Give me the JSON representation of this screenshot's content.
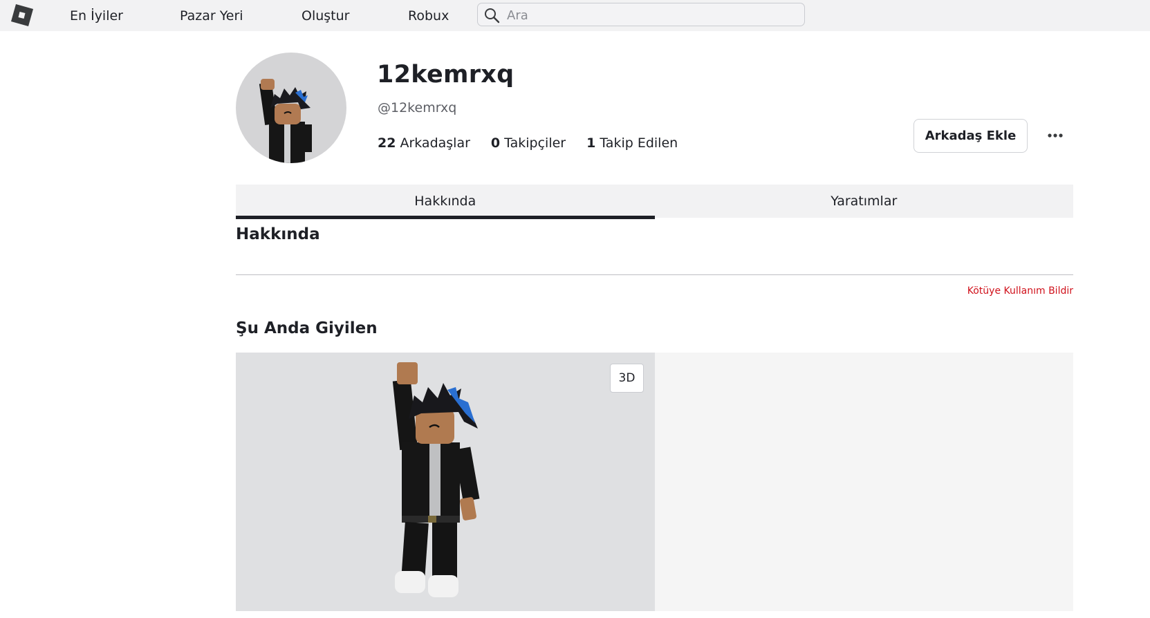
{
  "nav": {
    "items": [
      {
        "label": "En İyiler"
      },
      {
        "label": "Pazar Yeri"
      },
      {
        "label": "Oluştur"
      },
      {
        "label": "Robux"
      }
    ],
    "search_placeholder": "Ara",
    "logo_icon": "roblox-logo-icon",
    "search_icon": "search-icon"
  },
  "profile": {
    "display_name": "12kemrxq",
    "username": "@12kemrxq",
    "stats": [
      {
        "count": "22",
        "label": "Arkadaşlar"
      },
      {
        "count": "0",
        "label": "Takipçiler"
      },
      {
        "count": "1",
        "label": "Takip Edilen"
      }
    ],
    "add_friend_label": "Arkadaş Ekle",
    "more_icon": "more-horizontal-icon"
  },
  "tabs": [
    {
      "label": "Hakkında",
      "active": true
    },
    {
      "label": "Yaratımlar",
      "active": false
    }
  ],
  "about": {
    "title": "Hakkında",
    "report_label": "Kötüye Kullanım Bildir"
  },
  "wearing": {
    "title": "Şu Anda Giyilen",
    "three_d_label": "3D"
  },
  "colors": {
    "report_red": "#d0111b",
    "tab_indicator": "#1e2026",
    "nav_bg": "#f2f2f3"
  }
}
